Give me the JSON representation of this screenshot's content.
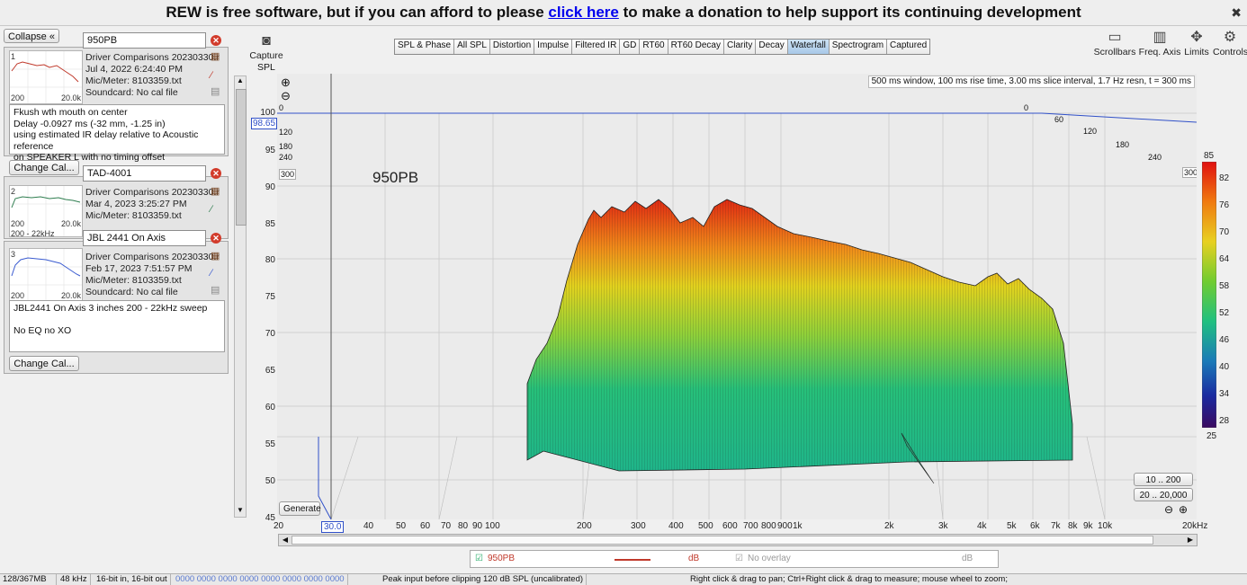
{
  "banner": {
    "pre": "REW is free software, but if you can afford to please ",
    "link": "click here",
    "post": " to make a donation to help support its continuing development",
    "close": "✖"
  },
  "left_panel": {
    "collapse_label": "Collapse «",
    "measurements": [
      {
        "name": "950PB",
        "index": "1",
        "file": "Driver Comparisons 20230330.r",
        "date": "Jul 4, 2022 6:24:40 PM",
        "mic": "Mic/Meter: 8103359.txt",
        "soundcard": "Soundcard: No cal file",
        "axis_left": "200",
        "axis_right": "20.0k",
        "notes": [
          "Fkush wth mouth on center",
          "Delay -0.0927 ms (-32 mm, -1.25 in)",
          "using estimated IR delay relative to Acoustic reference",
          "on SPEAKER L with no timing offset"
        ],
        "change_cal": "Change Cal...",
        "trace_color": "#c0392b"
      },
      {
        "name": "TAD-4001",
        "index": "2",
        "file": "Driver Comparisons 20230330.r",
        "date": "Mar 4, 2023 3:25:27 PM",
        "mic": "Mic/Meter: 8103359.txt",
        "axis_left": "200",
        "axis_right": "20.0k",
        "range": "200 - 22kHz",
        "trace_color": "#2e7d4f"
      },
      {
        "name": "JBL 2441 On Axis",
        "index": "3",
        "file": "Driver Comparisons 20230330.r",
        "date": "Feb 17, 2023 7:51:57 PM",
        "mic": "Mic/Meter: 8103359.txt",
        "soundcard": "Soundcard: No cal file",
        "axis_left": "200",
        "axis_right": "20.0k",
        "notes": [
          "JBL2441 On Axis 3 inches 200 - 22kHz sweep",
          "",
          "No EQ no XO"
        ],
        "change_cal": "Change Cal...",
        "trace_color": "#3a5bd0"
      }
    ]
  },
  "toolbar": {
    "capture": "Capture",
    "tabs": [
      "SPL & Phase",
      "All SPL",
      "Distortion",
      "Impulse",
      "Filtered IR",
      "GD",
      "RT60",
      "RT60 Decay",
      "Clarity",
      "Decay",
      "Waterfall",
      "Spectrogram",
      "Captured"
    ],
    "active_tab": "Waterfall",
    "right_buttons": [
      "Scrollbars",
      "Freq. Axis",
      "Limits",
      "Controls"
    ]
  },
  "plot": {
    "y_unit": "SPL",
    "info": "500 ms window, 100 ms rise time, 3.00 ms slice interval, 1.7 Hz resn, t = 300 ms",
    "series_label": "950PB",
    "cursor_spl": "98.65",
    "cursor_freq": "30.0",
    "y_ticks": [
      "100",
      "95",
      "90",
      "85",
      "80",
      "75",
      "70",
      "65",
      "60",
      "55",
      "50",
      "45"
    ],
    "x_ticks": [
      "20",
      "30.0",
      "40",
      "50",
      "60",
      "70",
      "80",
      "90",
      "100",
      "200",
      "300",
      "400",
      "500",
      "600",
      "700",
      "800",
      "900",
      "1k",
      "2k",
      "3k",
      "4k",
      "5k",
      "6k",
      "7k",
      "8k",
      "9k",
      "10k",
      "20kHz"
    ],
    "time_labels_left": [
      "0",
      "60",
      "120",
      "180",
      "240",
      "300"
    ],
    "time_labels_right": [
      "0",
      "60",
      "120",
      "180",
      "240",
      "300"
    ],
    "colorbar": [
      "85",
      "82",
      "76",
      "70",
      "64",
      "58",
      "52",
      "46",
      "40",
      "34",
      "28",
      "25"
    ],
    "generate": "Generate",
    "range_buttons": [
      "10 .. 200",
      "20 .. 20,000"
    ],
    "zoom_out": "⊖",
    "zoom_in": "⊕"
  },
  "overlay_legend": {
    "name": "950PB",
    "unit": "dB",
    "overlay": "No overlay",
    "overlay_unit": "dB"
  },
  "status": {
    "memory": "128/367MB",
    "rate": "48 kHz",
    "bits": "16-bit in, 16-bit out",
    "levels": "0000 0000  0000 0000  0000 0000  0000 0000",
    "peak": "Peak input before clipping 120 dB SPL (uncalibrated)",
    "hint": "Right click & drag to pan; Ctrl+Right click & drag to measure; mouse wheel to zoom;"
  }
}
